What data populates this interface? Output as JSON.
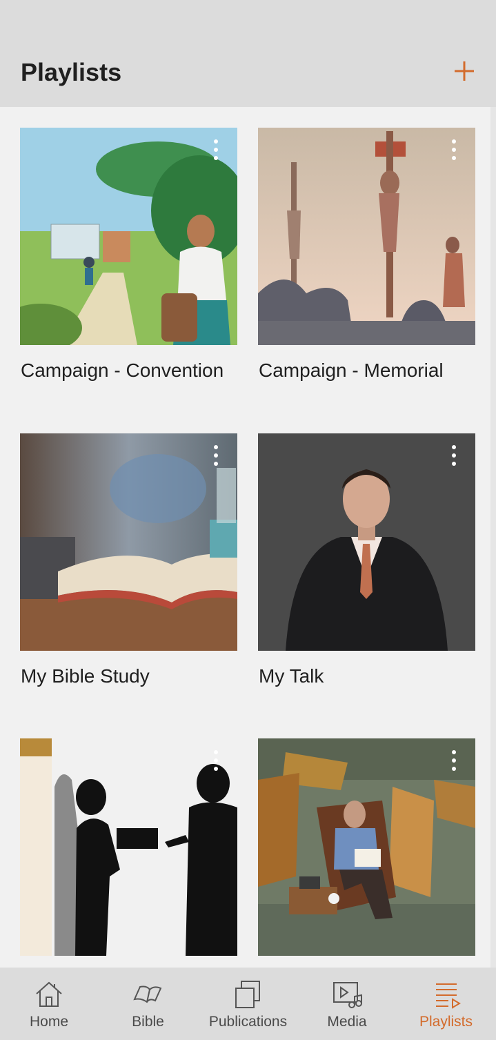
{
  "header": {
    "title": "Playlists",
    "add_icon": "plus-icon"
  },
  "colors": {
    "accent": "#d36b2c",
    "header_bg": "#dcdcdc",
    "page_bg": "#f1f1f1"
  },
  "playlists": [
    {
      "title": "Campaign - Convention"
    },
    {
      "title": "Campaign - Memorial"
    },
    {
      "title": "My Bible Study"
    },
    {
      "title": "My Talk"
    },
    {
      "title": ""
    },
    {
      "title": ""
    }
  ],
  "nav": {
    "items": [
      {
        "label": "Home",
        "icon": "home-icon"
      },
      {
        "label": "Bible",
        "icon": "book-icon"
      },
      {
        "label": "Publications",
        "icon": "publications-icon"
      },
      {
        "label": "Media",
        "icon": "media-icon"
      },
      {
        "label": "Playlists",
        "icon": "playlist-icon",
        "active": true
      }
    ]
  }
}
